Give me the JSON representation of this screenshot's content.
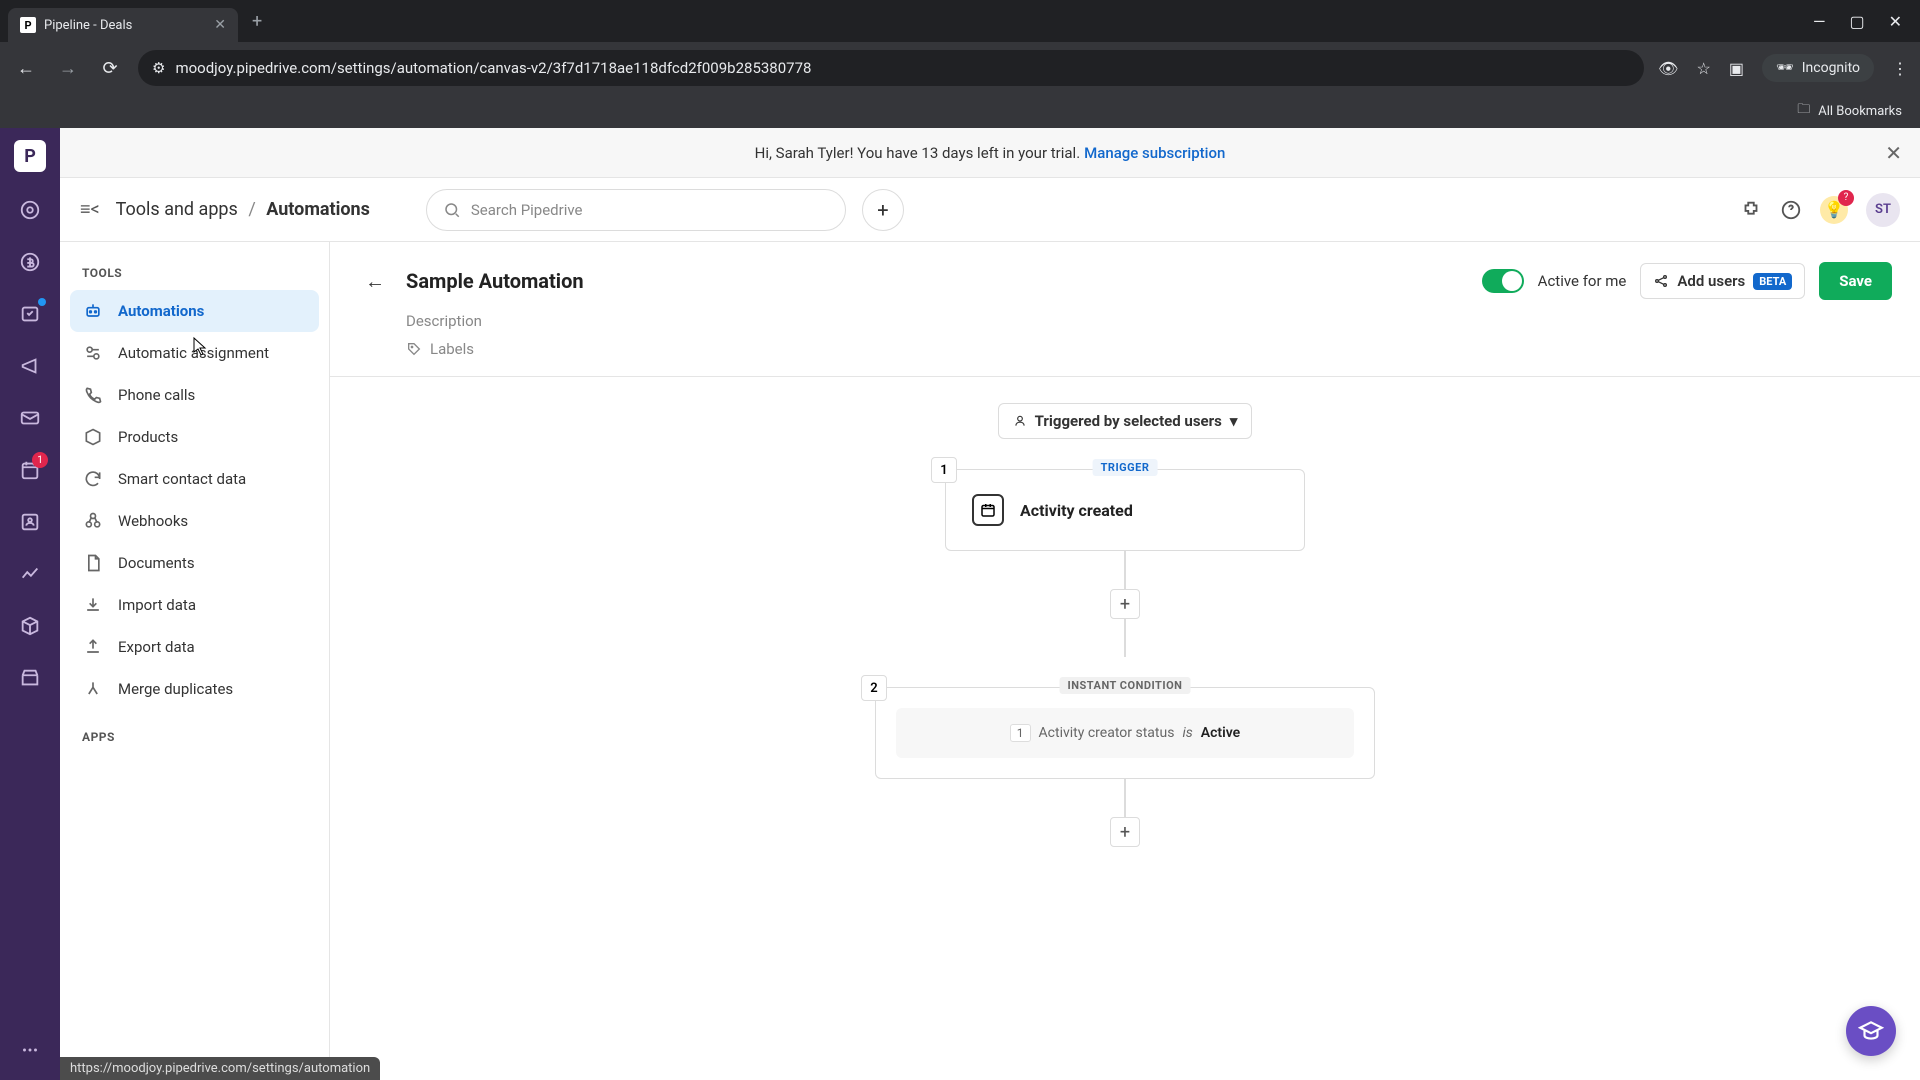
{
  "browser": {
    "tab_title": "Pipeline - Deals",
    "url": "moodjoy.pipedrive.com/settings/automation/canvas-v2/3f7d1718ae118dfcd2f009b285380778",
    "incognito_label": "Incognito",
    "bookmarks_label": "All Bookmarks",
    "favicon_letter": "P"
  },
  "banner": {
    "text": "Hi, Sarah Tyler! You have 13 days left in your trial.",
    "link": "Manage subscription"
  },
  "topbar": {
    "crumb_parent": "Tools and apps",
    "crumb_current": "Automations",
    "search_placeholder": "Search Pipedrive",
    "bulb_badge": "?",
    "avatar": "ST"
  },
  "sidebar": {
    "heading_tools": "TOOLS",
    "heading_apps": "APPS",
    "items": [
      {
        "label": "Automations"
      },
      {
        "label": "Automatic assignment"
      },
      {
        "label": "Phone calls"
      },
      {
        "label": "Products"
      },
      {
        "label": "Smart contact data"
      },
      {
        "label": "Webhooks"
      },
      {
        "label": "Documents"
      },
      {
        "label": "Import data"
      },
      {
        "label": "Export data"
      },
      {
        "label": "Merge duplicates"
      }
    ]
  },
  "automation": {
    "title": "Sample Automation",
    "description_placeholder": "Description",
    "labels_placeholder": "Labels",
    "toggle_label": "Active for me",
    "add_users_label": "Add users",
    "beta_label": "BETA",
    "save_label": "Save",
    "trigger_by": "Triggered by selected users"
  },
  "flow": {
    "step1_num": "1",
    "step1_badge": "TRIGGER",
    "step1_text": "Activity created",
    "step2_num": "2",
    "step2_badge": "INSTANT CONDITION",
    "cond_chip": "1",
    "cond_field": "Activity creator status",
    "cond_op": "is",
    "cond_value": "Active"
  },
  "rail": {
    "badge1": "1"
  },
  "status_url": "https://moodjoy.pipedrive.com/settings/automation"
}
